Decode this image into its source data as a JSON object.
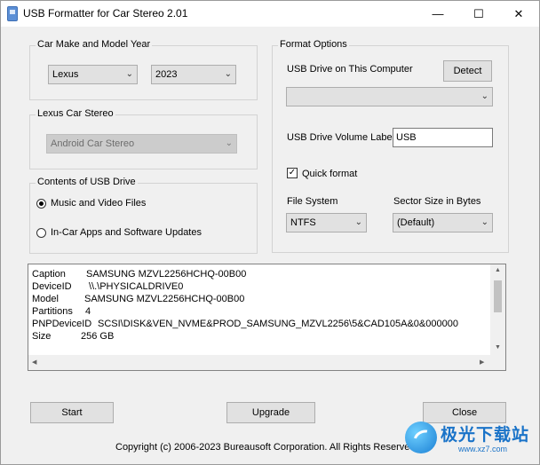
{
  "window": {
    "title": "USB Formatter for Car Stereo 2.01",
    "minimize_glyph": "—",
    "maximize_glyph": "☐",
    "close_glyph": "✕"
  },
  "car_make_group": {
    "legend": "Car Make and Model Year",
    "make": "Lexus",
    "year": "2023"
  },
  "car_stereo_group": {
    "legend": "Lexus Car Stereo",
    "stereo": "Android Car Stereo"
  },
  "contents_group": {
    "legend": "Contents of USB Drive",
    "option_music": "Music and Video Files",
    "option_apps": "In-Car Apps and Software Updates",
    "selected": "music"
  },
  "format_options": {
    "legend": "Format Options",
    "usb_drive_label": "USB Drive on This Computer",
    "detect_button": "Detect",
    "usb_drive_value": "",
    "volume_label_label": "USB Drive Volume Label",
    "volume_label_value": "USB",
    "quick_format_label": "Quick format",
    "quick_format_checked": true,
    "file_system_label": "File System",
    "file_system_value": "NTFS",
    "sector_size_label": "Sector Size in Bytes",
    "sector_size_value": "(Default)"
  },
  "device_info": {
    "rows": [
      {
        "key": "Caption",
        "value": "SAMSUNG MZVL2256HCHQ-00B00"
      },
      {
        "key": "DeviceID",
        "value": "\\\\.\\PHYSICALDRIVE0"
      },
      {
        "key": "Model",
        "value": "SAMSUNG MZVL2256HCHQ-00B00"
      },
      {
        "key": "Partitions",
        "value": "4"
      },
      {
        "key": "PNPDeviceID",
        "value": "SCSI\\DISK&VEN_NVME&PROD_SAMSUNG_MZVL2256\\5&CAD105A&0&000000"
      },
      {
        "key": "Size",
        "value": "256 GB"
      }
    ]
  },
  "buttons": {
    "start": "Start",
    "upgrade": "Upgrade",
    "close": "Close"
  },
  "footer": {
    "copyright": "Copyright (c) 2006-2023 Bureausoft Corporation. All Rights Reserved"
  },
  "watermark": {
    "text": "极光下载站",
    "url": "www.xz7.com"
  },
  "icons": {
    "chevron": "chevron-down-icon",
    "check": "checkmark-icon"
  }
}
